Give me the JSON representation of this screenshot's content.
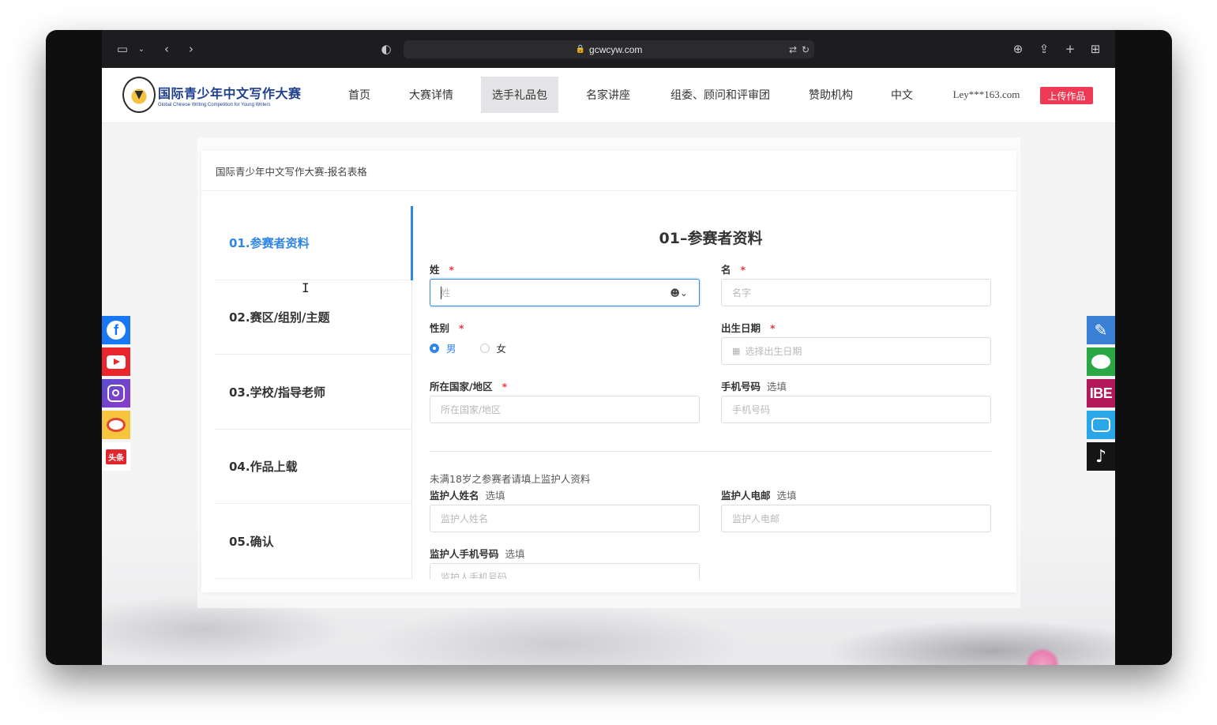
{
  "browser": {
    "url": "gcwcyw.com"
  },
  "site": {
    "logo_cn": "国际青少年中文写作大赛",
    "logo_en": "Global Chinese Writing Competition for Young Writers",
    "nav": [
      {
        "label": "首页"
      },
      {
        "label": "大赛详情"
      },
      {
        "label": "选手礼品包",
        "active": true
      },
      {
        "label": "名家讲座"
      },
      {
        "label": "组委、顾问和评审团"
      },
      {
        "label": "赞助机构"
      },
      {
        "label": "中文"
      },
      {
        "label": "Ley***163.com"
      }
    ],
    "upload_button": "上传作品"
  },
  "social": {
    "left": [
      "facebook-icon",
      "youtube-icon",
      "instagram-icon",
      "weibo-icon",
      "toutiao-icon"
    ],
    "toutiao_label": "头条",
    "right": [
      "pen-icon",
      "wechat-icon",
      "ibe-icon",
      "bilibili-icon",
      "douyin-icon"
    ],
    "ibe_label": "IBE"
  },
  "form": {
    "card_title": "国际青少年中文写作大赛-报名表格",
    "steps": [
      {
        "label": "01.参赛者资料",
        "active": true
      },
      {
        "label": "02.赛区/组别/主题"
      },
      {
        "label": "03.学校/指导老师"
      },
      {
        "label": "04.作品上载"
      },
      {
        "label": "05.确认"
      }
    ],
    "heading": "01–参赛者资料",
    "surname": {
      "label": "姓",
      "placeholder": "姓"
    },
    "given_name": {
      "label": "名",
      "placeholder": "名字"
    },
    "gender": {
      "label": "性别",
      "options": [
        "男",
        "女"
      ],
      "selected": "男"
    },
    "birthdate": {
      "label": "出生日期",
      "placeholder": "选择出生日期"
    },
    "country": {
      "label": "所在国家/地区",
      "placeholder": "所在国家/地区"
    },
    "phone": {
      "label": "手机号码",
      "optional": "选填",
      "placeholder": "手机号码"
    },
    "guardian_note": "未满18岁之参赛者请填上监护人资料",
    "guardian_name": {
      "label": "监护人姓名",
      "optional": "选填",
      "placeholder": "监护人姓名"
    },
    "guardian_email": {
      "label": "监护人电邮",
      "optional": "选填",
      "placeholder": "监护人电邮"
    },
    "guardian_phone": {
      "label": "监护人手机号码",
      "optional": "选填",
      "placeholder": "监护人手机号码"
    },
    "required_mark": "*"
  },
  "colors": {
    "accent": "#2f86e6",
    "required": "#e63946",
    "upload": "#ee3a55"
  }
}
